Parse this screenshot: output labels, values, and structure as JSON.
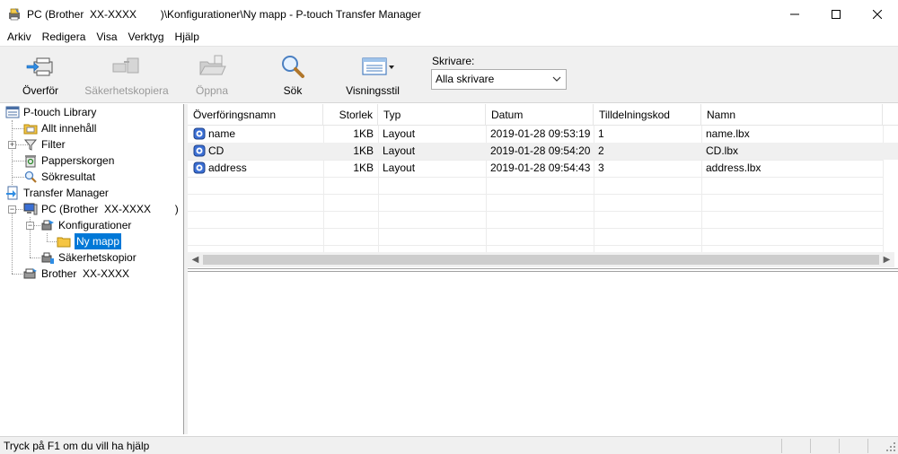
{
  "window": {
    "title": "PC (Brother  XX-XXXX        )\\Konfigurationer\\Ny mapp - P-touch Transfer Manager"
  },
  "menu": [
    "Arkiv",
    "Redigera",
    "Visa",
    "Verktyg",
    "Hjälp"
  ],
  "toolbar": {
    "transfer": "Överför",
    "backup": "Säkerhetskopiera",
    "open": "Öppna",
    "search": "Sök",
    "view_style": "Visningsstil",
    "printer_label": "Skrivare:",
    "printer_value": "Alla skrivare"
  },
  "tree": {
    "library": "P-touch Library",
    "all_content": "Allt innehåll",
    "filter": "Filter",
    "recycle": "Papperskorgen",
    "search_results": "Sökresultat",
    "transfer_manager": "Transfer Manager",
    "pc": "PC (Brother  XX-XXXX        )",
    "configurations": "Konfigurationer",
    "new_folder": "Ny mapp",
    "backups": "Säkerhetskopior",
    "brother": "Brother  XX-XXXX"
  },
  "list": {
    "columns": [
      "Överföringsnamn",
      "Storlek",
      "Typ",
      "Datum",
      "Tilldelningskod",
      "Namn"
    ],
    "rows": [
      {
        "name": "name",
        "size": "1KB",
        "type": "Layout",
        "date": "2019-01-28 09:53:19",
        "code": "1",
        "file": "name.lbx"
      },
      {
        "name": "CD",
        "size": "1KB",
        "type": "Layout",
        "date": "2019-01-28 09:54:20",
        "code": "2",
        "file": "CD.lbx"
      },
      {
        "name": "address",
        "size": "1KB",
        "type": "Layout",
        "date": "2019-01-28 09:54:43",
        "code": "3",
        "file": "address.lbx"
      }
    ]
  },
  "status": {
    "text": "Tryck på F1 om du vill ha hjälp"
  },
  "colors": {
    "selection": "#0078d7",
    "toolbar_bg": "#f0f0f0"
  }
}
